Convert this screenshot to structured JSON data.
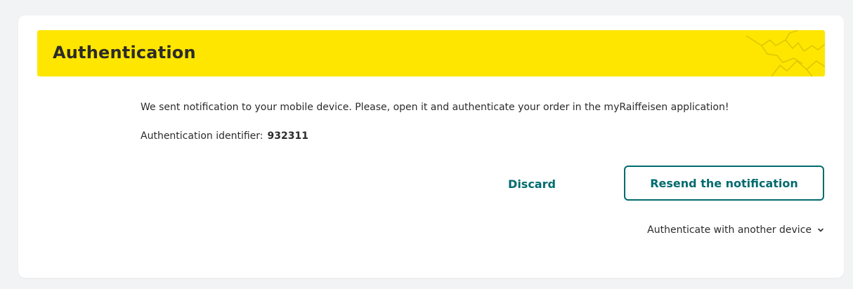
{
  "header": {
    "title": "Authentication",
    "logo_icon": "raiffeisen-crossed-gables-logo"
  },
  "body": {
    "message": "We sent notification to your mobile device. Please, open it and authenticate your order in the myRaiffeisen application!",
    "identifier_label": "Authentication identifier:",
    "identifier_value": "932311"
  },
  "actions": {
    "discard_label": "Discard",
    "resend_label": "Resend the notification",
    "another_device_label": "Authenticate with another device",
    "another_device_icon": "chevron-down-icon"
  },
  "colors": {
    "accent": "#006b6e",
    "banner": "#fee600",
    "text": "#2b2b2b"
  }
}
